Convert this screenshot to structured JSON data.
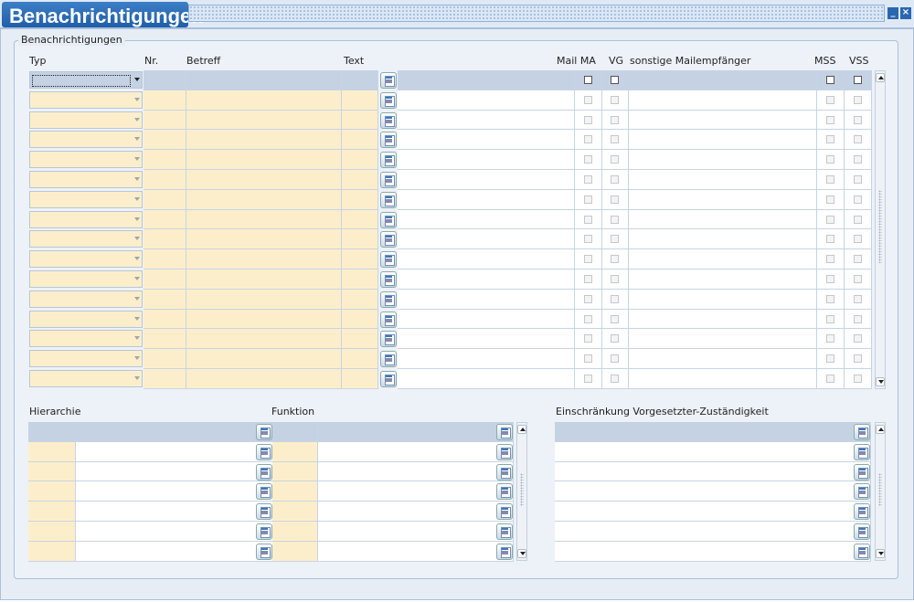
{
  "window": {
    "title": "Benachrichtigungen",
    "minimize_glyph": "_",
    "close_glyph": "×"
  },
  "group": {
    "label": "Benachrichtigungen"
  },
  "main_table": {
    "columns": {
      "typ": "Typ",
      "nr": "Nr.",
      "betreff": "Betreff",
      "text": "Text",
      "mail_ma": "Mail MA",
      "vg": "VG",
      "sonstige": "sonstige Mailempfänger",
      "mss": "MSS",
      "vss": "VSS"
    },
    "row_count": 16,
    "rows": []
  },
  "hierarchie": {
    "label": "Hierarchie",
    "row_count": 7
  },
  "funktion": {
    "label": "Funktion",
    "row_count": 7
  },
  "einschraenkung": {
    "label": "Einschränkung Vorgesetzter-Zuständigkeit",
    "row_count": 7
  },
  "icons": {
    "edit": "edit-note-icon",
    "scroll_up": "scroll-up-arrow-icon",
    "scroll_down": "scroll-down-arrow-icon",
    "dropdown": "chevron-down-icon"
  },
  "colors": {
    "title_bg": "#2a67b1",
    "editable_cell": "#fdeecb",
    "active_row": "#c5d2e3",
    "panel_bg": "#e6edf5"
  }
}
